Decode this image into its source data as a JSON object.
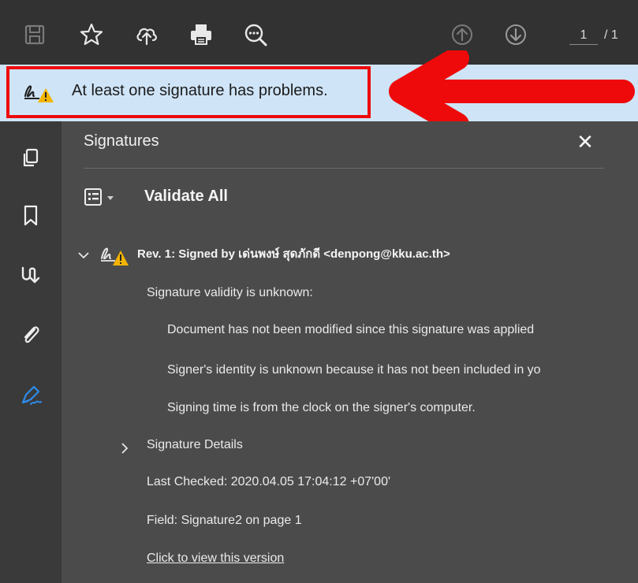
{
  "toolbar": {
    "icons": [
      "save-icon",
      "star-icon",
      "cloud-upload-icon",
      "print-icon",
      "zoom-icon",
      "page-up-icon",
      "page-down-icon"
    ],
    "page_current": "1",
    "page_total": "/ 1"
  },
  "banner": {
    "message": "At least one signature has problems.",
    "icon": "signature-warning-icon",
    "highlight_color": "#ee0a0a"
  },
  "left_rail": {
    "icons": [
      "pages-icon",
      "bookmark-icon",
      "attachments-flow-icon",
      "paperclip-icon",
      "signature-pen-icon"
    ]
  },
  "panel": {
    "title": "Signatures",
    "close_label": "✕",
    "validate_all": "Validate All",
    "revision": {
      "title": "Rev. 1: Signed by เด่นพงษ์ สุดภักดี <denpong@kku.ac.th>",
      "validity": "Signature validity is unknown:",
      "details": [
        "Document has not been modified since this signature was applied",
        "Signer's identity is unknown because it has not been included in yo",
        "Signing time is from the clock on the signer's computer."
      ],
      "signature_details": "Signature Details",
      "last_checked": "Last Checked: 2020.04.05 17:04:12 +07'00'",
      "field": "Field: Signature2 on page 1",
      "view_version": "Click to view this version"
    }
  },
  "colors": {
    "toolbar_bg": "#323232",
    "panel_bg": "#4b4b4b",
    "banner_bg": "#cfe4f7",
    "warning": "#f4b400",
    "active_icon": "#2d8ceb"
  }
}
